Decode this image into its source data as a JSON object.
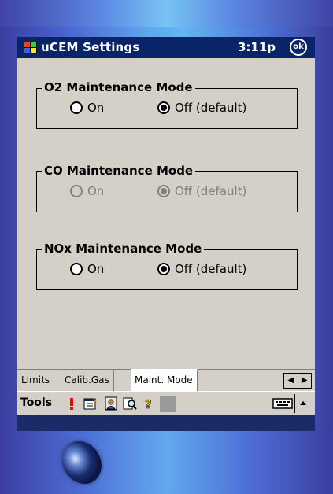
{
  "titlebar": {
    "title": "uCEM Settings",
    "clock": "3:11p",
    "ok_label": "ok"
  },
  "groups": [
    {
      "label": "O2 Maintenance Mode",
      "on_label": "On",
      "off_label": "Off (default)",
      "selected": "off",
      "enabled": true
    },
    {
      "label": "CO Maintenance Mode",
      "on_label": "On",
      "off_label": "Off (default)",
      "selected": "off",
      "enabled": false
    },
    {
      "label": "NOx Maintenance Mode",
      "on_label": "On",
      "off_label": "Off (default)",
      "selected": "off",
      "enabled": true
    }
  ],
  "tabs": [
    {
      "label": "Limits",
      "active": false
    },
    {
      "label": "Calib.Gas",
      "active": false
    },
    {
      "label": "Maint. Mode",
      "active": true
    }
  ],
  "toolbar": {
    "tools_label": "Tools",
    "icons": [
      "exclamation-icon",
      "properties-icon",
      "user-icon",
      "find-icon",
      "help-icon",
      "blank-icon",
      "keyboard-icon",
      "up-arrow-icon"
    ]
  },
  "colors": {
    "titlebar_bg": "#0a246a",
    "screen_bg": "#d4d0c8",
    "exclamation": "#ff0000",
    "help": "#ffcc00"
  }
}
